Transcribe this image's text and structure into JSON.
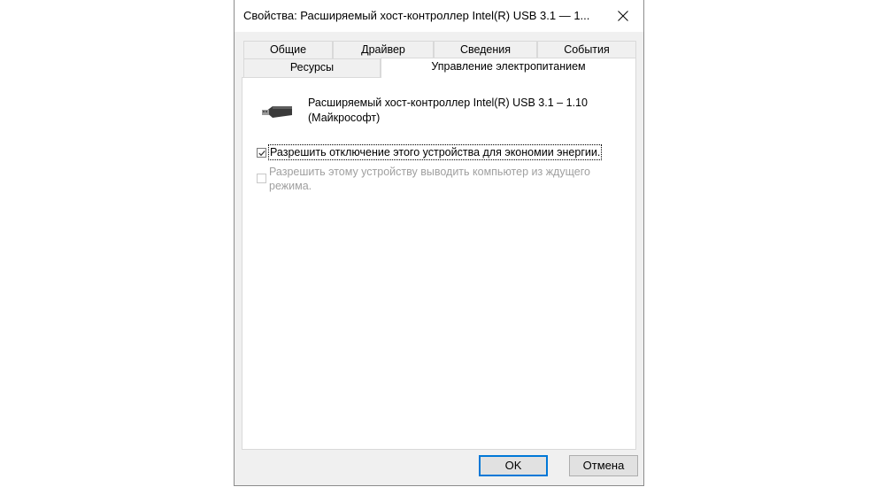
{
  "window": {
    "title": "Свойства: Расширяемый хост-контроллер Intel(R) USB 3.1 — 1...",
    "close_icon": "close-icon"
  },
  "tabs": {
    "row1": [
      "Общие",
      "Драйвер",
      "Сведения",
      "События"
    ],
    "row2": [
      "Ресурсы",
      "Управление электропитанием"
    ],
    "active": "Управление электропитанием"
  },
  "device": {
    "icon": "usb-plug-icon",
    "name": "Расширяемый хост-контроллер Intel(R) USB 3.1 – 1.10 (Майкрософт)"
  },
  "options": {
    "allow_turn_off": {
      "label": "Разрешить отключение этого устройства для экономии энергии.",
      "checked": true,
      "enabled": true
    },
    "allow_wake": {
      "label": "Разрешить этому устройству выводить компьютер из ждущего режима.",
      "checked": false,
      "enabled": false
    }
  },
  "buttons": {
    "ok": "OK",
    "cancel": "Отмена"
  }
}
